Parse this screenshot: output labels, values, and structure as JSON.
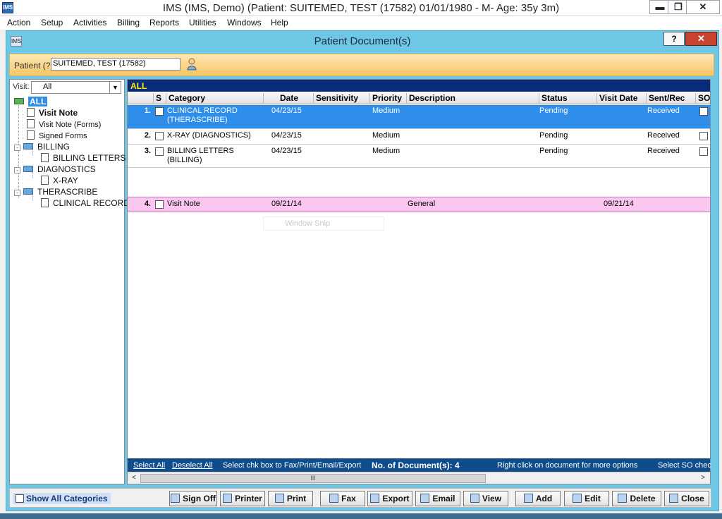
{
  "app": {
    "title": "IMS (IMS, Demo)    (Patient: SUITEMED, TEST  (17582) 01/01/1980 - M- Age: 35y 3m)",
    "icon_text": "IMS",
    "window_buttons": {
      "minimize": "▬",
      "restore": "❐",
      "close": "✕"
    }
  },
  "menu": [
    "Action",
    "Setup",
    "Activities",
    "Billing",
    "Reports",
    "Utilities",
    "Windows",
    "Help"
  ],
  "dialog": {
    "title": "Patient Document(s)",
    "help_label": "?",
    "close_label": "✕"
  },
  "patient": {
    "label": "Patient (?)",
    "value": "SUITEMED, TEST  (17582)"
  },
  "visit_filter": {
    "label": "Visit:",
    "value": "All",
    "arrow": "▼"
  },
  "tree": {
    "root": "ALL",
    "items": [
      {
        "label": "Visit Note"
      },
      {
        "label": "Visit Note (Forms)"
      },
      {
        "label": "Signed Forms"
      },
      {
        "label": "BILLING",
        "child": "BILLING LETTERS"
      },
      {
        "label": "DIAGNOSTICS",
        "child": "X-RAY"
      },
      {
        "label": "THERASCRIBE",
        "child": "CLINICAL RECORD"
      }
    ],
    "expander": "-"
  },
  "grid": {
    "heading": "ALL",
    "columns": [
      "S",
      "Category",
      "Date",
      "Sensitivity",
      "Priority",
      "Description",
      "Status",
      "Visit Date",
      "Sent/Rec",
      "SO"
    ],
    "rows": [
      {
        "num": "1.",
        "category": "CLINICAL RECORD",
        "category2": "(THERASCRIBE)",
        "date": "04/23/15",
        "priority": "Medium",
        "description": "",
        "status": "Pending",
        "visit_date": "",
        "sent_rec": "Received"
      },
      {
        "num": "2.",
        "category": "X-RAY (DIAGNOSTICS)",
        "category2": "",
        "date": "04/23/15",
        "priority": "Medium",
        "description": "",
        "status": "Pending",
        "visit_date": "",
        "sent_rec": "Received"
      },
      {
        "num": "3.",
        "category": "BILLING LETTERS",
        "category2": "(BILLING)",
        "date": "04/23/15",
        "priority": "Medium",
        "description": "",
        "status": "Pending",
        "visit_date": "",
        "sent_rec": "Received"
      },
      {
        "num": "4.",
        "category": "Visit Note",
        "category2": "",
        "date": "09/21/14",
        "priority": "",
        "description": "General",
        "status": "",
        "visit_date": "09/21/14",
        "sent_rec": ""
      }
    ],
    "ghost_text": "Window Snip"
  },
  "footer": {
    "select_all": "Select All",
    "deselect_all": "Deselect All",
    "hint": "Select chk box to Fax/Print/Email/Export",
    "count_label": "No. of Document(s): 4",
    "right_click_hint": "Right click on document for more options",
    "select_so": "Select SO chec",
    "scroll_left": "<",
    "scroll_right": ">",
    "scroll_grip": "III"
  },
  "toolbar": {
    "show_all": "Show All Categories",
    "buttons": [
      {
        "label": "Sign Off",
        "icon": "sign-off-icon"
      },
      {
        "label": "Printer",
        "icon": "printer-setup-icon"
      },
      {
        "label": "Print",
        "icon": "print-icon"
      },
      {
        "label": "Fax",
        "icon": "fax-icon"
      },
      {
        "label": "Export",
        "icon": "export-icon"
      },
      {
        "label": "Email",
        "icon": "email-icon"
      },
      {
        "label": "View",
        "icon": "view-icon"
      },
      {
        "label": "Add",
        "icon": "add-icon"
      },
      {
        "label": "Edit",
        "icon": "edit-icon"
      },
      {
        "label": "Delete",
        "icon": "delete-icon"
      },
      {
        "label": "Close",
        "icon": "close-icon"
      }
    ]
  },
  "colors": {
    "grid_heading_bg": "#0a2a7a",
    "grid_heading_text": "#fff200",
    "selected_row": "#2f8ee9",
    "pink_row": "#fbc7f0",
    "dialog_frame": "#6fc7e6"
  }
}
